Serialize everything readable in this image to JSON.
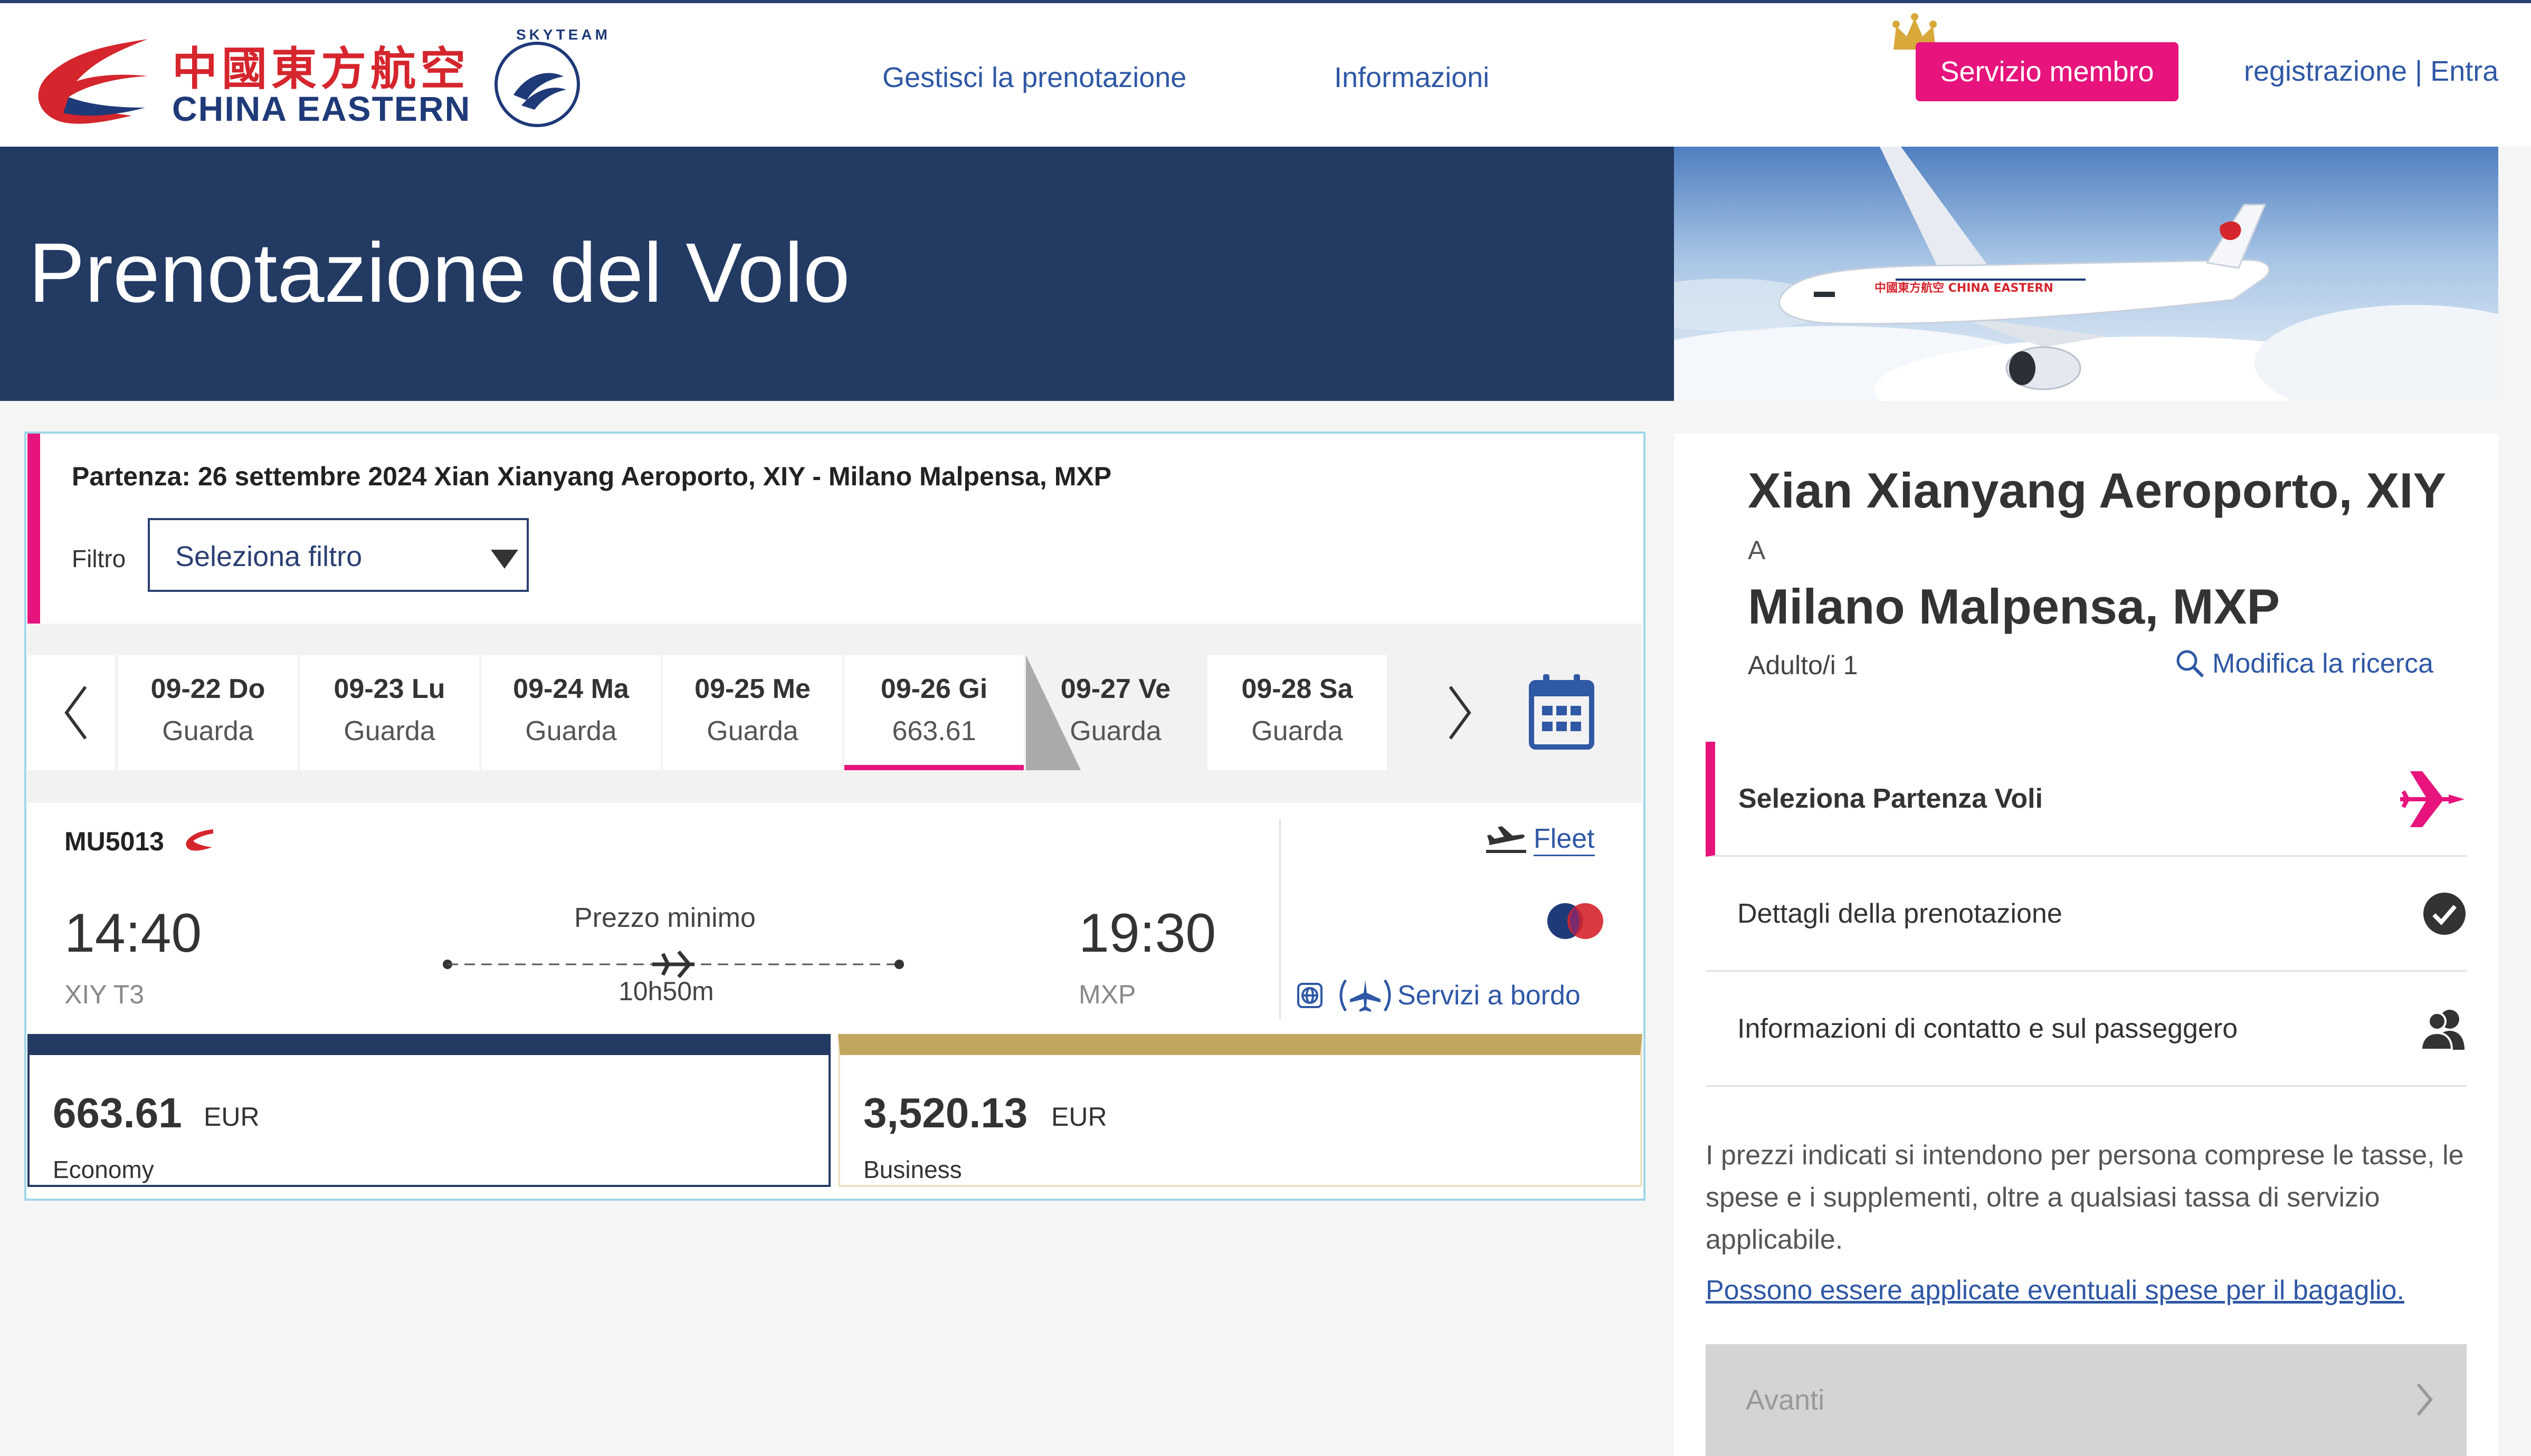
{
  "header": {
    "logo_cn": "中國東方航空",
    "logo_en": "CHINA EASTERN",
    "skyteam": "SKYTEAM",
    "nav": [
      "Gestisci la prenotazione",
      "Informazioni"
    ],
    "member_button": "Servizio membro",
    "auth_links": "registrazione | Entra"
  },
  "banner": {
    "title": "Prenotazione del Volo",
    "plane_livery": "中國東方航空   CHINA EASTERN"
  },
  "search": {
    "departure_line": "Partenza: 26 settembre 2024 Xian Xianyang Aeroporto, XIY - Milano Malpensa, MXP",
    "filter_label": "Filtro",
    "filter_value": "Seleziona filtro"
  },
  "dates": [
    {
      "date": "09-22 Do",
      "price": "Guarda"
    },
    {
      "date": "09-23 Lu",
      "price": "Guarda"
    },
    {
      "date": "09-24 Ma",
      "price": "Guarda"
    },
    {
      "date": "09-25 Me",
      "price": "Guarda"
    },
    {
      "date": "09-26 Gi",
      "price": "663.61"
    },
    {
      "date": "09-27 Ve",
      "price": "Guarda"
    },
    {
      "date": "09-28 Sa",
      "price": "Guarda"
    }
  ],
  "flight": {
    "number": "MU5013",
    "fleet": "Fleet",
    "depart_time": "14:40",
    "depart_airport": "XIY T3",
    "arrive_time": "19:30",
    "arrive_airport": "MXP",
    "label": "Prezzo minimo",
    "duration": "10h50m",
    "services": "Servizi a bordo"
  },
  "fares": [
    {
      "amount": "663.61",
      "currency": "EUR",
      "cabin": "Economy",
      "color": "#233a63"
    },
    {
      "amount": "3,520.13",
      "currency": "EUR",
      "cabin": "Business",
      "color": "#c2a65f"
    }
  ],
  "summary": {
    "origin": "Xian Xianyang Aeroporto, XIY",
    "to": "A",
    "destination": "Milano Malpensa, MXP",
    "passengers": "Adulto/i 1",
    "modify": "Modifica la ricerca",
    "steps": [
      "Seleziona Partenza Voli",
      "Dettagli della prenotazione",
      "Informazioni di contatto e sul passeggero"
    ],
    "note": "I prezzi indicati si intendono per persona comprese le tasse, le spese e i supplementi, oltre a qualsiasi tassa di servizio applicabile.",
    "baggage_link": "Possono essere applicate eventuali spese per il bagaglio.",
    "next_button": "Avanti"
  },
  "colors": {
    "navy": "#233a63",
    "accent": "#e6147c",
    "link": "#2f58a5",
    "gold": "#c2a65f"
  }
}
